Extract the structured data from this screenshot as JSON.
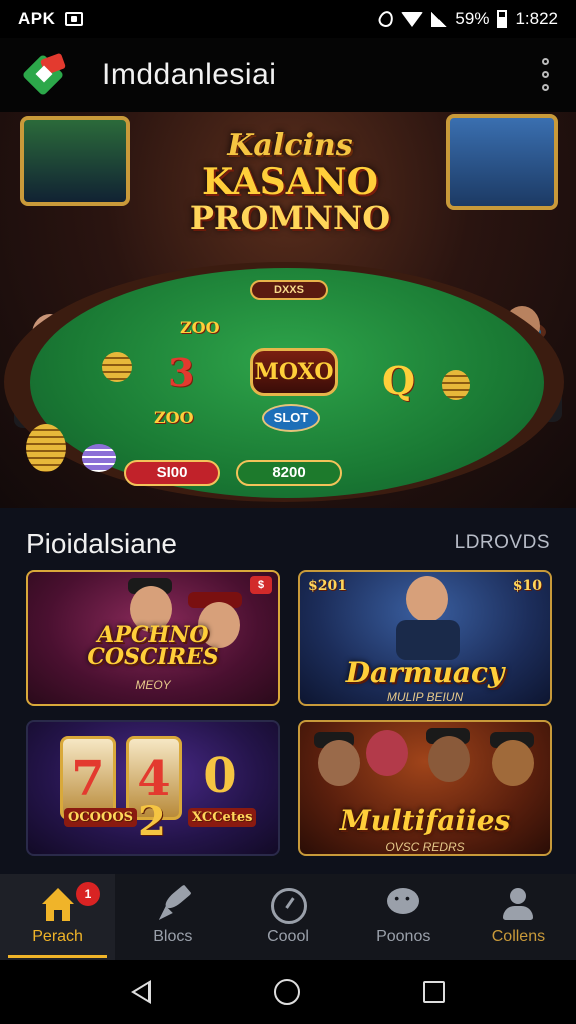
{
  "status_bar": {
    "carrier": "APK",
    "battery": "59%",
    "time": "1:822"
  },
  "app_bar": {
    "title": "Imddanlesiai"
  },
  "hero": {
    "title_line1": "Kalcins",
    "title_line2": "KASANO",
    "title_line3": "PROMNNO",
    "top_badge": "DXXS",
    "center_badge": "MOXO",
    "slot_badge": "SLOT",
    "chip_a": "ZOO",
    "chip_b": "3",
    "chip_c": "Q",
    "chip_d": "ZOO",
    "bet_red": "SI00",
    "bet_green": "8200"
  },
  "section": {
    "title": "Pioidalsiane",
    "link": "LDROVDS"
  },
  "games": [
    {
      "title": "APCHNO\nCOSCIRES",
      "corner": "$",
      "sub": "MEOY"
    },
    {
      "title": "Darmuacy",
      "corner_left": "$201",
      "corner_right": "$10",
      "sub": "MULIP BEIUN"
    },
    {
      "title": "740",
      "reel_1": "7",
      "reel_2": "4",
      "reel_3": "0",
      "sub_left": "OCOOOS",
      "sub_big": "2",
      "sub_right": "XCCetes"
    },
    {
      "title": "Multifaiies",
      "sub": "OVSC REDRS"
    }
  ],
  "bottom_nav": [
    {
      "label": "Perach",
      "icon": "home-icon",
      "badge": "1",
      "active": true
    },
    {
      "label": "Blocs",
      "icon": "rocket-icon"
    },
    {
      "label": "Coool",
      "icon": "clock-icon"
    },
    {
      "label": "Poonos",
      "icon": "chat-icon"
    },
    {
      "label": "Collens",
      "icon": "user-icon"
    }
  ],
  "colors": {
    "accent": "#f0b429",
    "felt": "#1a7a34",
    "badge_red": "#d92323"
  }
}
